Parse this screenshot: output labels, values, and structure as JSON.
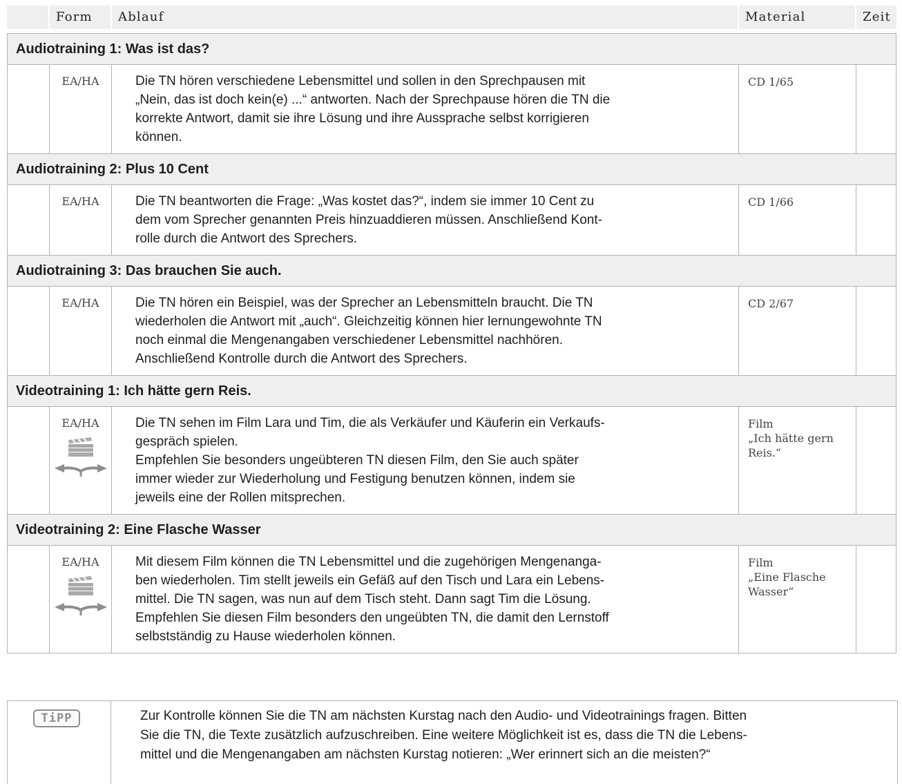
{
  "header": {
    "form": "Form",
    "ablauf": "Ablauf",
    "material": "Material",
    "zeit": "Zeit"
  },
  "sections": [
    {
      "title": "Audiotraining 1: Was ist das?",
      "form": "EA/HA",
      "lines": [
        "Die TN hören verschiedene Lebensmittel und sollen in den Sprechpausen mit",
        "„Nein, das ist doch kein(e) ...“ antworten. Nach der Sprechpause hören die TN die",
        "korrekte Antwort, damit sie ihre Lösung und ihre Aussprache selbst korrigieren",
        "können."
      ],
      "material": [
        "CD 1/65"
      ]
    },
    {
      "title": "Audiotraining 2: Plus 10 Cent",
      "form": "EA/HA",
      "lines": [
        "Die TN beantworten die Frage: „Was kostet das?“, indem sie immer 10 Cent zu",
        "dem vom Sprecher genannten Preis hinzuaddieren müssen. Anschließend Kont-",
        "rolle durch die Antwort des Sprechers."
      ],
      "material": [
        "CD 1/66"
      ]
    },
    {
      "title": "Audiotraining 3: Das brauchen Sie auch.",
      "form": "EA/HA",
      "lines": [
        "Die TN hören ein Beispiel, was der Sprecher an Lebensmitteln braucht. Die TN",
        "wiederholen die Antwort mit „auch“. Gleichzeitig können hier lernungewohnte TN",
        "noch einmal die Mengenangaben verschiedener Lebensmittel nachhören.",
        "Anschließend Kontrolle durch die Antwort des Sprechers."
      ],
      "material": [
        "CD 2/67"
      ]
    },
    {
      "title": "Videotraining 1: Ich hätte gern Reis.",
      "form": "EA/HA",
      "lines": [
        "Die TN sehen im Film Lara und Tim, die als Verkäufer und Käuferin ein Verkaufs-",
        "gespräch spielen.",
        "Empfehlen Sie besonders ungeübteren TN diesen Film, den Sie auch später",
        "immer wieder zur Wiederholung und Festigung benutzen können, indem sie",
        "jeweils eine der Rollen mitsprechen."
      ],
      "material": [
        "Film",
        "„Ich hätte gern",
        "Reis.“"
      ],
      "icons": [
        "film-clapper-icon",
        "exchange-arrows-icon"
      ]
    },
    {
      "title": "Videotraining 2: Eine Flasche Wasser",
      "form": "EA/HA",
      "lines": [
        "Mit diesem Film können die TN Lebensmittel und die zugehörigen Mengenanga-",
        "ben wiederholen. Tim stellt jeweils ein Gefäß auf den Tisch und Lara ein Lebens-",
        "mittel. Die TN sagen, was nun auf dem Tisch steht. Dann sagt Tim die Lösung.",
        "Empfehlen Sie diesen Film besonders den ungeübten TN, die damit den Lernstoff",
        "selbstständig zu Hause wiederholen können."
      ],
      "material": [
        "Film",
        "„Eine Flasche",
        "Wasser“"
      ],
      "icons": [
        "film-clapper-icon",
        "exchange-arrows-icon"
      ]
    }
  ],
  "tip": {
    "badge": "TiPP",
    "lines": [
      "Zur Kontrolle können Sie die TN am nächsten Kurstag nach den Audio- und Videotrainings fragen. Bitten",
      "Sie die TN, die Texte zusätzlich aufzuschreiben. Eine weitere Möglichkeit ist es, dass die TN die Lebens-",
      "mittel und die Mengenangaben am nächsten Kurstag notieren: „Wer erinnert sich an die meisten?“"
    ]
  },
  "colors": {
    "header_bg": "#efefef",
    "border": "#b3b3b3",
    "icon_gray": "#8e8e8e"
  }
}
